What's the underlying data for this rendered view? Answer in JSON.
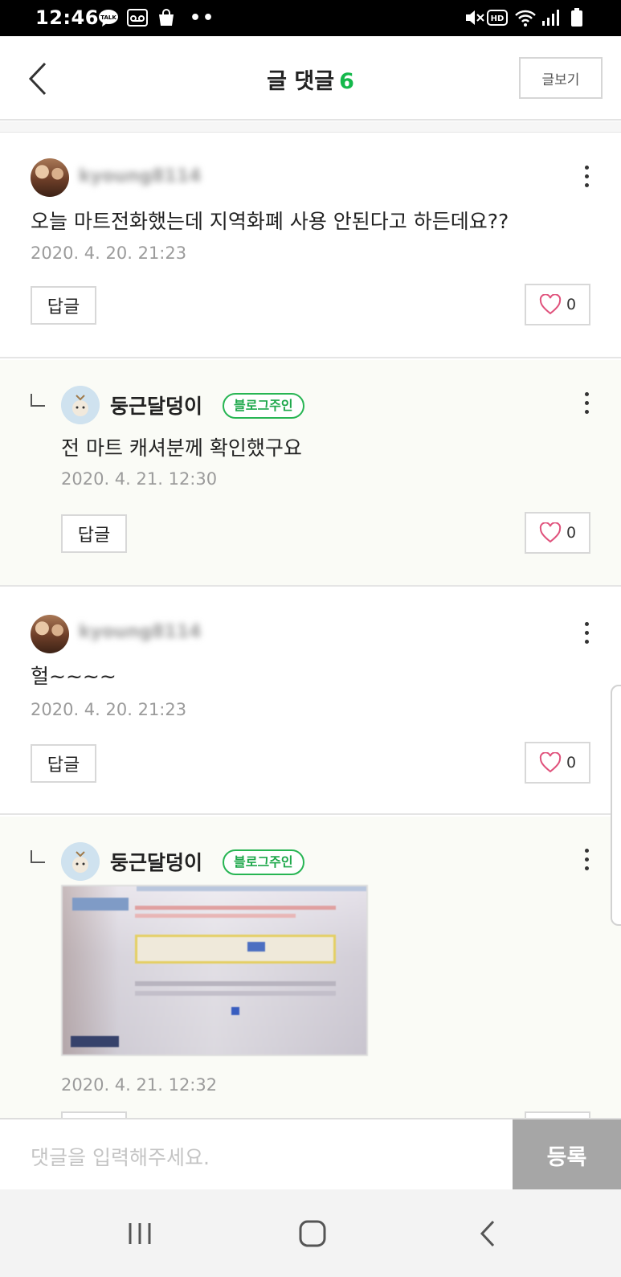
{
  "status_bar": {
    "time": "12:46",
    "left_icons": [
      "talk-icon",
      "voicemail-icon",
      "shopping-bag-icon"
    ],
    "right_icons": [
      "mute-icon",
      "hd-icon",
      "wifi-icon",
      "signal-icon",
      "battery-icon"
    ]
  },
  "header": {
    "title": "글 댓글",
    "count": "6",
    "view_post_label": "글보기",
    "accent_color": "#14b84b"
  },
  "comments": [
    {
      "author": "kyoung8114",
      "is_owner": false,
      "text": "오늘 마트전화했는데 지역화폐 사용 안된다고 하든데요??",
      "date": "2020. 4. 20. 21:23",
      "reply_label": "답글",
      "likes": "0"
    },
    {
      "author": "둥근달덩이",
      "is_owner": true,
      "badge": "블로그주인",
      "text": "전 마트 캐셔분께 확인했구요",
      "date": "2020. 4. 21. 12:30",
      "reply_label": "답글",
      "likes": "0"
    },
    {
      "author": "kyoung8114",
      "is_owner": false,
      "text": "헐~~~~",
      "date": "2020. 4. 20. 21:23",
      "reply_label": "답글",
      "likes": "0"
    },
    {
      "author": "둥근달덩이",
      "is_owner": true,
      "badge": "블로그주인",
      "date": "2020. 4. 21. 12:32"
    }
  ],
  "input": {
    "placeholder": "댓글을 입력해주세요.",
    "submit_label": "등록"
  },
  "nav_bar": {
    "icons": [
      "recent-apps-icon",
      "home-icon",
      "back-icon"
    ]
  }
}
